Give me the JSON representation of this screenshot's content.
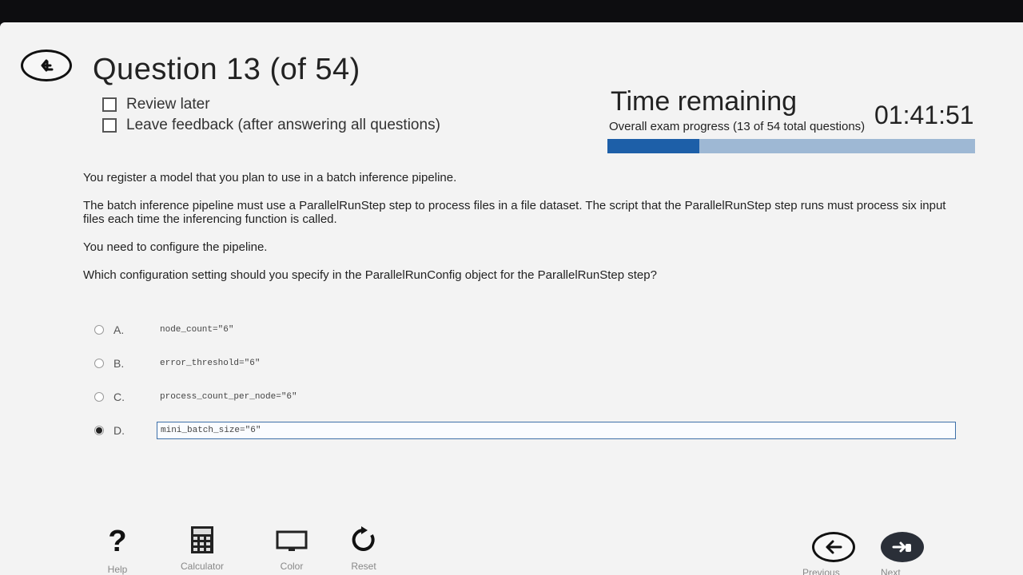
{
  "header": {
    "question_title": "Question 13 (of 54)",
    "review_later": "Review later",
    "leave_feedback": "Leave feedback (after answering all questions)"
  },
  "timer": {
    "label": "Time remaining",
    "value": "01:41:51"
  },
  "progress": {
    "text": "Overall exam progress (13 of 54 total questions)",
    "fraction": 0.25
  },
  "question": {
    "paragraphs": [
      "You register a model that you plan to use in a batch inference pipeline.",
      "The batch inference pipeline must use a ParallelRunStep step to process files in a file dataset. The script that the ParallelRunStep step runs must process six input files each time the inferencing function is called.",
      "You need to configure the pipeline.",
      "Which configuration setting should you specify in the ParallelRunConfig object for the ParallelRunStep step?"
    ]
  },
  "options": [
    {
      "letter": "A.",
      "code": "node_count=\"6\"",
      "selected": false
    },
    {
      "letter": "B.",
      "code": "error_threshold=\"6\"",
      "selected": false
    },
    {
      "letter": "C.",
      "code": "process_count_per_node=\"6\"",
      "selected": false
    },
    {
      "letter": "D.",
      "code": "mini_batch_size=\"6\"",
      "selected": true
    }
  ],
  "toolbar": {
    "help_label": "Help",
    "calculator_label": "Calculator",
    "color_label": "Color",
    "reset_label": "Reset",
    "previous_label": "Previous",
    "next_label": "Next"
  },
  "icons": {
    "upload": "upload-icon",
    "help": "question-mark-icon",
    "calculator": "calculator-icon",
    "color": "monitor-icon",
    "reset": "reset-icon",
    "previous": "arrow-left-icon",
    "next": "hand-pointer-icon"
  },
  "colors": {
    "progress_fill": "#1d5fa8",
    "progress_track": "#9eb8d4",
    "selected_border": "#3d6fa8"
  }
}
